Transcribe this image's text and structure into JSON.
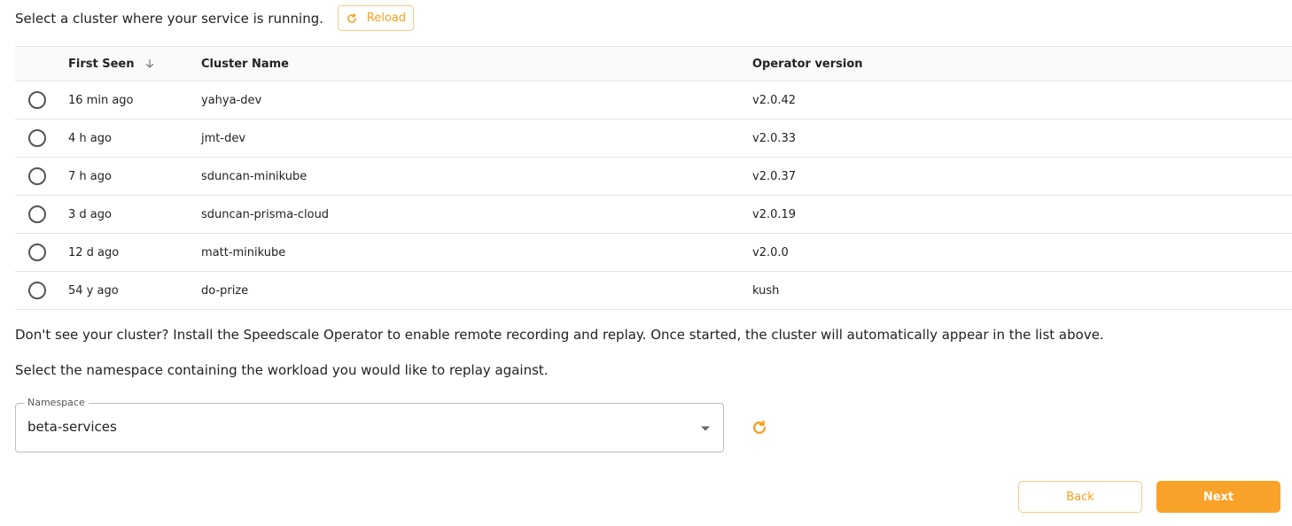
{
  "header": {
    "prompt": "Select a cluster where your service is running.",
    "reload_label": "Reload"
  },
  "table": {
    "columns": {
      "first_seen": "First Seen",
      "cluster_name": "Cluster Name",
      "operator_version": "Operator version"
    },
    "sort_icon": "arrow-down-icon",
    "rows": [
      {
        "first_seen": "16 min ago",
        "cluster_name": "yahya-dev",
        "operator_version": "v2.0.42"
      },
      {
        "first_seen": "4 h ago",
        "cluster_name": "jmt-dev",
        "operator_version": "v2.0.33"
      },
      {
        "first_seen": "7 h ago",
        "cluster_name": "sduncan-minikube",
        "operator_version": "v2.0.37"
      },
      {
        "first_seen": "3 d ago",
        "cluster_name": "sduncan-prisma-cloud",
        "operator_version": "v2.0.19"
      },
      {
        "first_seen": "12 d ago",
        "cluster_name": "matt-minikube",
        "operator_version": "v2.0.0"
      },
      {
        "first_seen": "54 y ago",
        "cluster_name": "do-prize",
        "operator_version": "kush"
      }
    ]
  },
  "info": {
    "no_cluster": "Don't see your cluster? Install the Speedscale Operator to enable remote recording and replay. Once started, the cluster will automatically appear in the list above.",
    "namespace_prompt": "Select the namespace containing the workload you would like to replay against."
  },
  "namespace": {
    "label": "Namespace",
    "value": "beta-services"
  },
  "footer": {
    "back_label": "Back",
    "next_label": "Next"
  },
  "colors": {
    "accent": "#f9a22a",
    "accent_border": "#f9c98a"
  }
}
